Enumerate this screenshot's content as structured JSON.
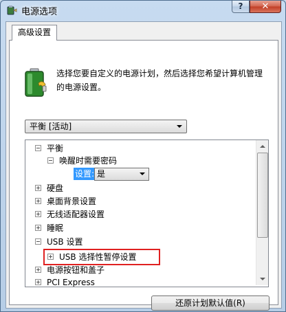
{
  "window": {
    "title": "电源选项",
    "help_label": "?",
    "close_label": "✕",
    "icon": "power-options-icon"
  },
  "tab": {
    "label": "高级设置"
  },
  "description": "选择您要自定义的电源计划，然后选择您希望计算机管理的电源设置。",
  "plan_select": {
    "value": "平衡 [活动]"
  },
  "tree": {
    "items": [
      {
        "label": "平衡",
        "state": "expanded"
      },
      {
        "label": "唤醒时需要密码",
        "state": "expanded"
      },
      {
        "label": "硬盘",
        "state": "collapsed"
      },
      {
        "label": "桌面背景设置",
        "state": "collapsed"
      },
      {
        "label": "无线适配器设置",
        "state": "collapsed"
      },
      {
        "label": "睡眠",
        "state": "collapsed"
      },
      {
        "label": "USB 设置",
        "state": "expanded"
      },
      {
        "label": "USB 选择性暂停设置",
        "state": "collapsed"
      },
      {
        "label": "电源按钮和盖子",
        "state": "collapsed"
      },
      {
        "label": "PCI Express",
        "state": "collapsed"
      }
    ],
    "setting_label": "设置:",
    "setting_value": "是"
  },
  "buttons": {
    "restore_defaults": "还原计划默认值(R)"
  },
  "colors": {
    "selection": "#3399ff",
    "highlight_box": "#e02020",
    "close_button": "#c13e26"
  }
}
